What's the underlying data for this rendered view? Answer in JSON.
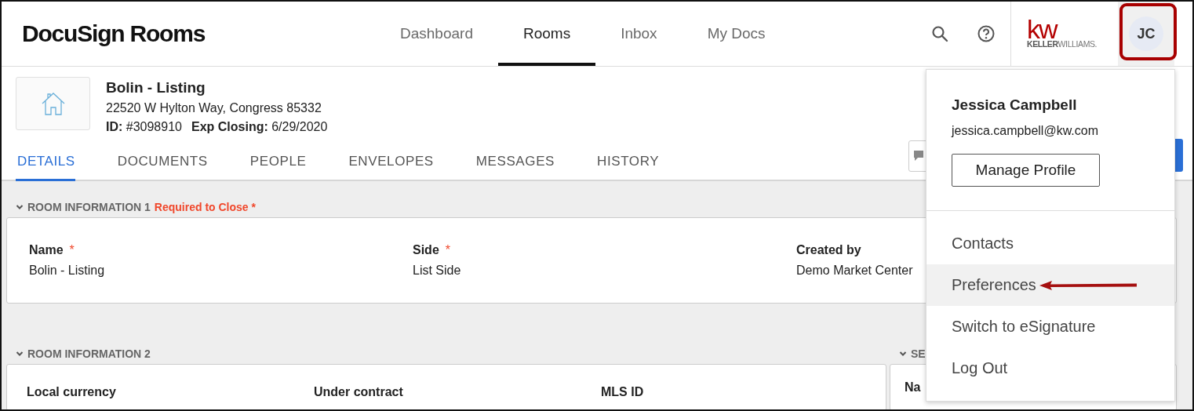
{
  "app": {
    "logo": "DocuSign Rooms",
    "nav": [
      {
        "label": "Dashboard",
        "selected": false
      },
      {
        "label": "Rooms",
        "selected": true
      },
      {
        "label": "Inbox",
        "selected": false
      },
      {
        "label": "My Docs",
        "selected": false
      }
    ],
    "brand": {
      "mark": "kw",
      "name_bold": "KELLER",
      "name_light": "WILLIAMS."
    },
    "avatar": {
      "initials": "JC"
    }
  },
  "room": {
    "title": "Bolin - Listing",
    "address": "22520 W Hylton Way, Congress 85332",
    "id_label": "ID:",
    "id": "#3098910",
    "closing_label": "Exp Closing:",
    "closing": "6/29/2020"
  },
  "tabs": [
    {
      "label": "DETAILS",
      "selected": true
    },
    {
      "label": "DOCUMENTS",
      "selected": false
    },
    {
      "label": "PEOPLE",
      "selected": false
    },
    {
      "label": "ENVELOPES",
      "selected": false
    },
    {
      "label": "MESSAGES",
      "selected": false
    },
    {
      "label": "HISTORY",
      "selected": false
    }
  ],
  "sections": [
    {
      "title": "ROOM INFORMATION 1",
      "note": "Required to Close *",
      "fields": [
        {
          "label": "Name",
          "mark": "*",
          "value": "Bolin - Listing"
        },
        {
          "label": "Side",
          "mark": "*",
          "value": "List Side"
        },
        {
          "label": "Created by",
          "value": "Demo Market Center"
        }
      ]
    },
    {
      "title": "ROOM INFORMATION 2",
      "fields": [
        {
          "label": "Local currency"
        },
        {
          "label": "Under contract"
        },
        {
          "label": "MLS ID"
        }
      ]
    }
  ],
  "side_section": {
    "title": "SE",
    "field_label": "Na"
  },
  "user_menu": {
    "name": "Jessica Campbell",
    "email": "jessica.campbell@kw.com",
    "button": "Manage Profile",
    "items": [
      {
        "label": "Contacts",
        "selected": false
      },
      {
        "label": "Preferences",
        "selected": true
      },
      {
        "label": "Switch to eSignature",
        "selected": false
      },
      {
        "label": "Log Out",
        "selected": false
      }
    ]
  }
}
